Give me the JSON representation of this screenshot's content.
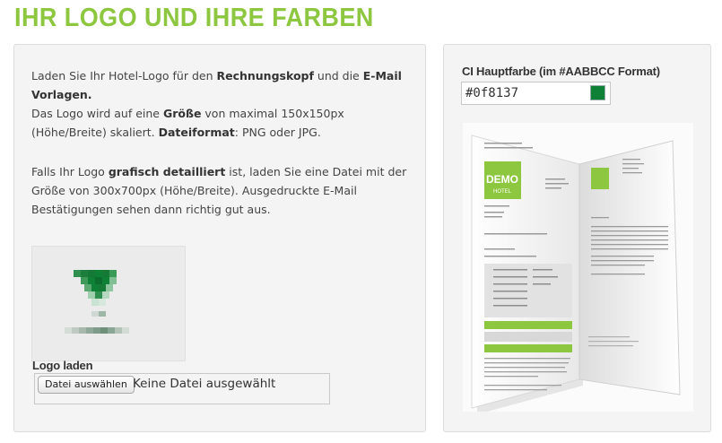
{
  "header": {
    "title": "IHR LOGO UND IHRE FARBEN"
  },
  "logo_section": {
    "desc1": {
      "t1": "Laden Sie Ihr Hotel-Logo für den ",
      "b1": "Rechnungskopf",
      "t2": " und die ",
      "b2": "E-Mail Vorlagen.",
      "t3": "Das Logo wird auf eine ",
      "b3": "Größe",
      "t4": " von maximal 150x150px (Höhe/Breite) skaliert. ",
      "b4": "Dateiformat",
      "t5": ": PNG oder JPG."
    },
    "desc2": {
      "t1": "Falls Ihr Logo ",
      "b1": "grafisch detailliert",
      "t2": " ist, laden Sie eine Datei mit der Größe von 300x700px (Höhe/Breite). Ausgedruckte E-Mail Bestätigungen sehen dann richtig gut aus."
    },
    "upload_label": "Logo laden",
    "file_button": "Datei auswählen",
    "file_status": "Keine Datei ausgewählt"
  },
  "color_section": {
    "label": "CI Hauptfarbe (im #AABBCC Format)",
    "value": "#0f8137",
    "swatch_color": "#0f8137"
  },
  "preview": {
    "logo_text_top": "DEMO",
    "logo_text_bottom": "HOTEL",
    "accent_color": "#8dc63f"
  }
}
